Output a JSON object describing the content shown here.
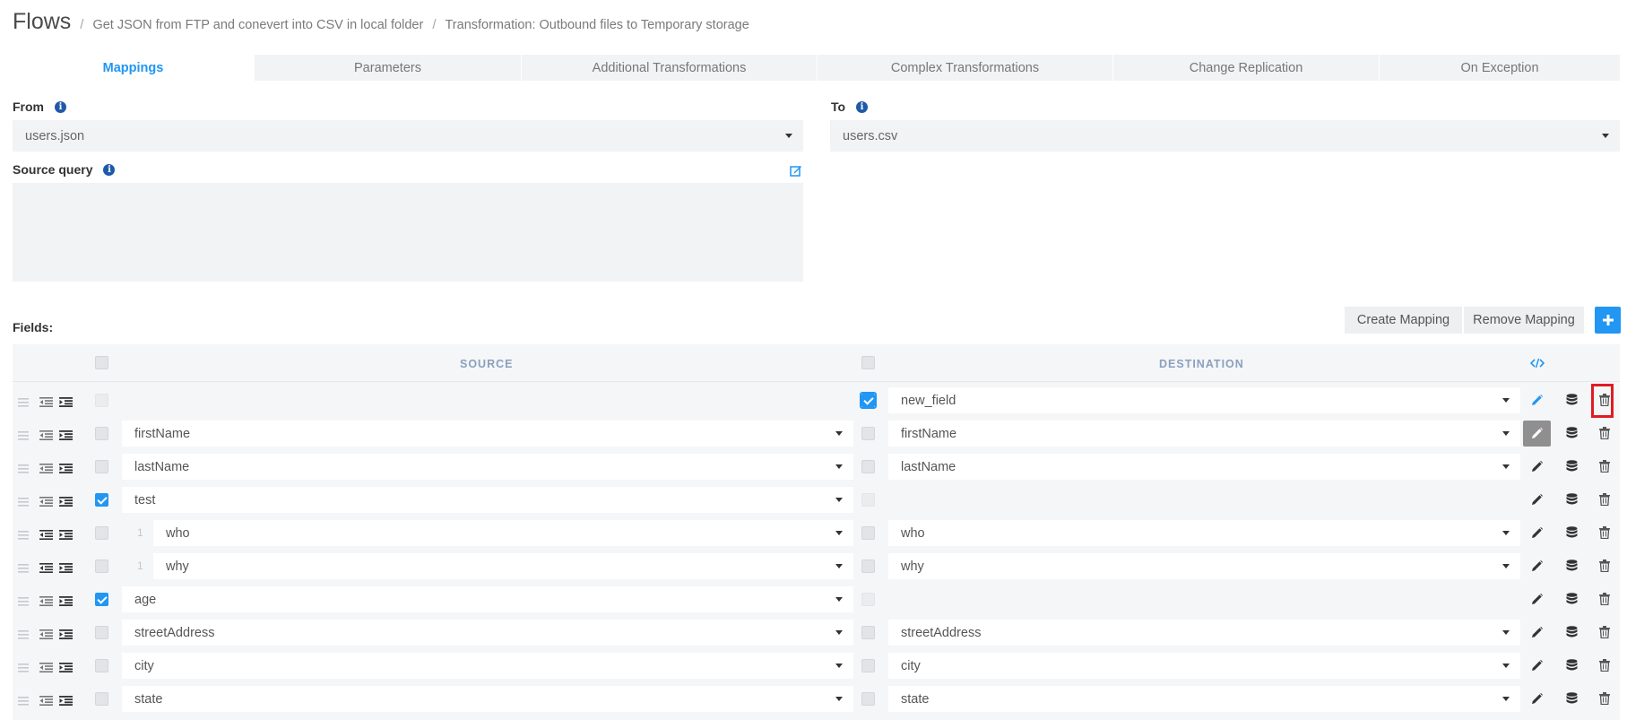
{
  "breadcrumb": {
    "root": "Flows",
    "separator": "/",
    "items": [
      "Get JSON from FTP and conevert into CSV in local folder",
      "Transformation: Outbound files to Temporary storage"
    ]
  },
  "tabs": [
    {
      "label": "Mappings",
      "active": true
    },
    {
      "label": "Parameters",
      "active": false
    },
    {
      "label": "Additional Transformations",
      "active": false
    },
    {
      "label": "Complex Transformations",
      "active": false
    },
    {
      "label": "Change Replication",
      "active": false
    },
    {
      "label": "On Exception",
      "active": false
    }
  ],
  "form": {
    "from_label": "From",
    "from_value": "users.json",
    "to_label": "To",
    "to_value": "users.csv",
    "source_query_label": "Source query"
  },
  "toolbar": {
    "fields_label": "Fields:",
    "create_mapping": "Create Mapping",
    "remove_mapping": "Remove Mapping"
  },
  "table": {
    "source_header": "SOURCE",
    "destination_header": "DESTINATION",
    "rows": [
      {
        "source": null,
        "level": null,
        "source_checked": false,
        "destination": "new_field",
        "destination_checked": true
      },
      {
        "source": "firstName",
        "level": null,
        "source_checked": false,
        "destination": "firstName",
        "destination_checked": false
      },
      {
        "source": "lastName",
        "level": null,
        "source_checked": false,
        "destination": "lastName",
        "destination_checked": false
      },
      {
        "source": "test",
        "level": null,
        "source_checked": true,
        "destination": null,
        "destination_checked": false
      },
      {
        "source": "who",
        "level": "1",
        "source_checked": false,
        "destination": "who",
        "destination_checked": false
      },
      {
        "source": "why",
        "level": "1",
        "source_checked": false,
        "destination": "why",
        "destination_checked": false
      },
      {
        "source": "age",
        "level": null,
        "source_checked": true,
        "destination": null,
        "destination_checked": false
      },
      {
        "source": "streetAddress",
        "level": null,
        "source_checked": false,
        "destination": "streetAddress",
        "destination_checked": false
      },
      {
        "source": "city",
        "level": null,
        "source_checked": false,
        "destination": "city",
        "destination_checked": false
      },
      {
        "source": "state",
        "level": null,
        "source_checked": false,
        "destination": "state",
        "destination_checked": false
      }
    ]
  },
  "icons": {
    "drag": "drag-handle-icon",
    "outdent": "outdent-icon",
    "indent": "indent-icon",
    "edit": "pencil-icon",
    "database": "database-icon",
    "delete": "trash-icon",
    "code": "code-icon",
    "add": "plus-icon",
    "info": "info-icon"
  },
  "colors": {
    "accent": "#2196f3",
    "highlight": "#e01b24",
    "header_text": "#8aa0be"
  }
}
